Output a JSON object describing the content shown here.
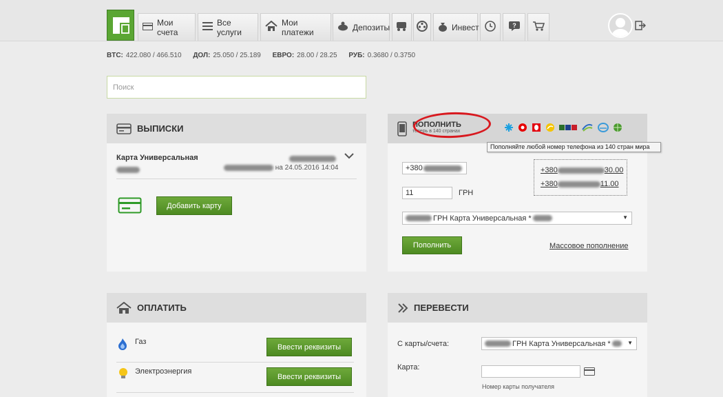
{
  "nav": {
    "tabs": [
      {
        "label": "Мои счета",
        "icon": "card-icon"
      },
      {
        "label": "Все услуги",
        "icon": "list-icon"
      },
      {
        "label": "Мои платежи",
        "icon": "house-icon"
      },
      {
        "label": "Депозиты",
        "icon": "piggy-bank-icon"
      },
      {
        "label": "Инвест",
        "icon": "money-bag-icon"
      }
    ]
  },
  "rates": {
    "btc_label": "BTC:",
    "btc_value": "422.080 / 466.510",
    "usd_label": "ДОЛ:",
    "usd_value": "25.050 / 25.189",
    "eur_label": "ЕВРО:",
    "eur_value": "28.00 / 28.25",
    "rub_label": "РУБ:",
    "rub_value": "0.3680 / 0.3750"
  },
  "search": {
    "placeholder": "Поиск"
  },
  "statements": {
    "title": "ВЫПИСКИ",
    "card_name": "Карта Универсальная",
    "date_prefix": "на 24.05.2016 14:04",
    "add_card_label": "Добавить карту"
  },
  "topup": {
    "title": "ПОПОЛНИТЬ",
    "subtitle": "теперь в 140 странах",
    "tooltip": "Пополняйте любой номер телефона из 140 стран мира",
    "phone_prefix": "+380",
    "amount": "11",
    "currency": "ГРН",
    "account_select": "ГРН  Карта Универсальная *",
    "recent1_prefix": "+380",
    "recent1_suffix": "30.00",
    "recent2_prefix": "+380",
    "recent2_suffix": "11.00",
    "submit_label": "Пополнить",
    "mass_label": "Массовое пополнение"
  },
  "pay": {
    "title": "ОПЛАТИТЬ",
    "items": [
      {
        "label": "Газ",
        "button": "Ввести реквизиты"
      },
      {
        "label": "Электроэнергия",
        "button": "Ввести реквизиты"
      }
    ]
  },
  "transfer": {
    "title": "ПЕРЕВЕСТИ",
    "from_label": "С карты/счета:",
    "from_select": "ГРН  Карта Универсальная *",
    "card_label": "Карта:",
    "card_hint": "Номер карты получателя"
  },
  "colors": {
    "brand_green": "#5aa633",
    "button_green": "#4d8a22",
    "red_mark": "#d8191f"
  }
}
